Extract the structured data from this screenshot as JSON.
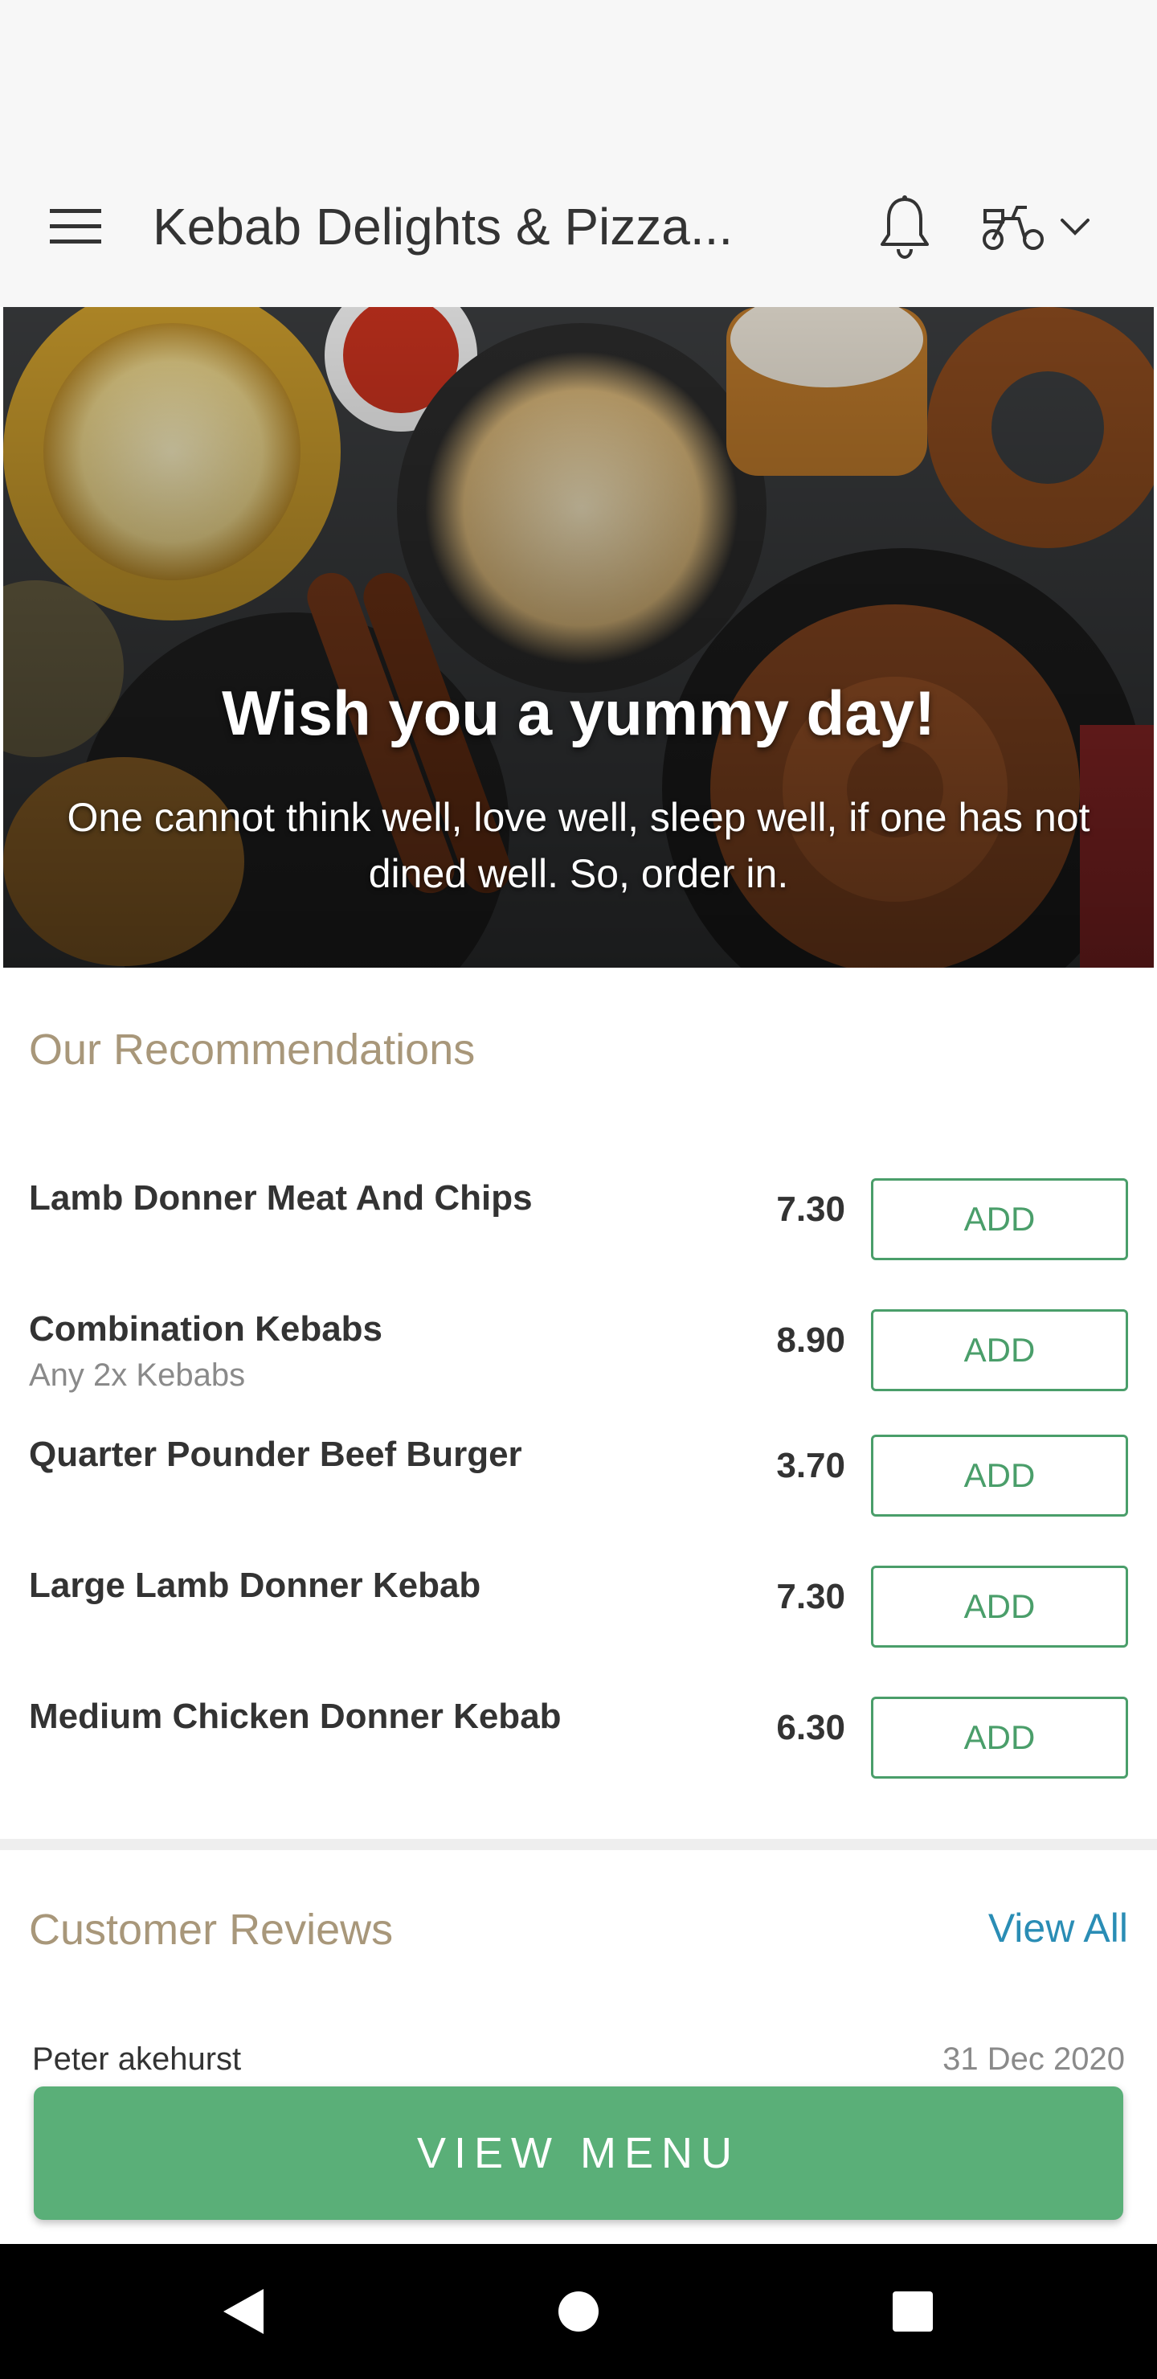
{
  "app_bar": {
    "title": "Kebab Delights & Pizza...",
    "menu_icon": "hamburger-menu-icon",
    "bell_icon": "bell-icon",
    "delivery_icon": "scooter-icon",
    "dropdown_icon": "chevron-down-icon"
  },
  "hero": {
    "title": "Wish you a yummy day!",
    "subtitle": "One cannot think well, love well, sleep well, if one has not dined well. So, order in."
  },
  "recommendations": {
    "title": "Our Recommendations",
    "add_label": "ADD",
    "items": [
      {
        "name": "Lamb Donner Meat And Chips",
        "description": "",
        "price": "7.30"
      },
      {
        "name": "Combination Kebabs",
        "description": "Any 2x Kebabs",
        "price": "8.90"
      },
      {
        "name": "Quarter Pounder Beef Burger",
        "description": "",
        "price": "3.70"
      },
      {
        "name": "Large Lamb Donner Kebab",
        "description": "",
        "price": "7.30"
      },
      {
        "name": "Medium Chicken Donner Kebab",
        "description": "",
        "price": "6.30"
      }
    ]
  },
  "reviews": {
    "title": "Customer Reviews",
    "view_all": "View All",
    "first_review": {
      "name": "Peter akehurst",
      "date": "31 Dec 2020"
    }
  },
  "cta": {
    "label": "VIEW MENU"
  },
  "colors": {
    "accent_green": "#5aaf78",
    "add_border": "#4a9e6a",
    "section_title": "#a8977a",
    "link_blue": "#2a8db5"
  }
}
